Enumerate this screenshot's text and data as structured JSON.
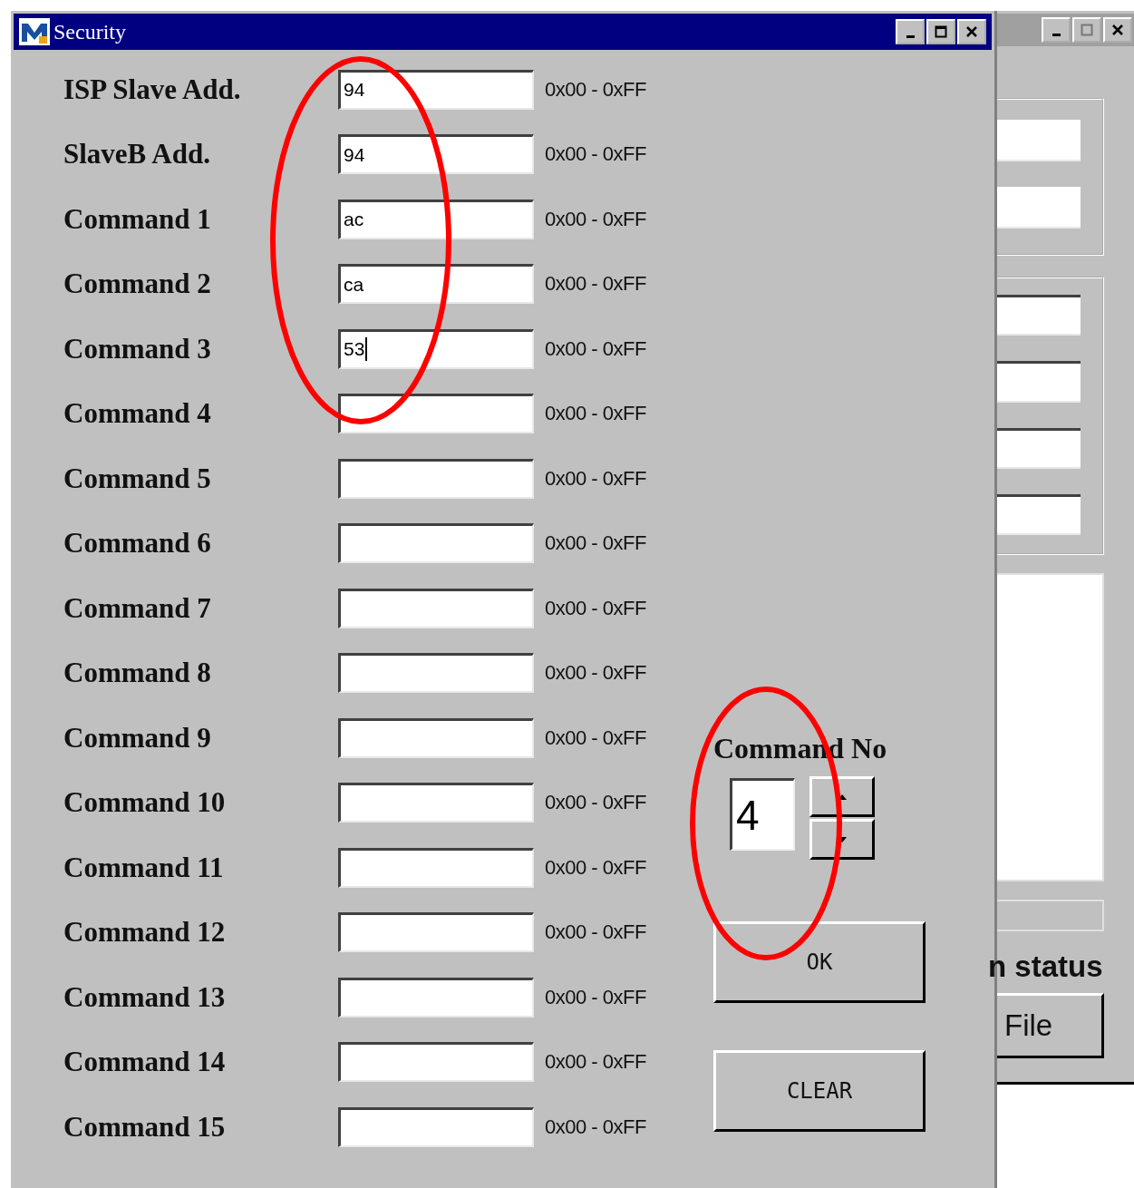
{
  "window": {
    "title": "Security"
  },
  "fields": [
    {
      "label": "ISP Slave Add.",
      "value": "94",
      "range": "0x00 - 0xFF",
      "focused": false
    },
    {
      "label": "SlaveB Add.",
      "value": "94",
      "range": "0x00 - 0xFF",
      "focused": false
    },
    {
      "label": "Command 1",
      "value": "ac",
      "range": "0x00 - 0xFF",
      "focused": false
    },
    {
      "label": "Command 2",
      "value": "ca",
      "range": "0x00 - 0xFF",
      "focused": false
    },
    {
      "label": "Command 3",
      "value": "53",
      "range": "0x00 - 0xFF",
      "focused": true
    },
    {
      "label": "Command 4",
      "range": "0x00 - 0xFF",
      "focused": false
    },
    {
      "label": "Command 5",
      "range": "0x00 - 0xFF",
      "focused": false
    },
    {
      "label": "Command 6",
      "range": "0x00 - 0xFF",
      "focused": false
    },
    {
      "label": "Command 7",
      "range": "0x00 - 0xFF",
      "focused": false
    },
    {
      "label": "Command 8",
      "range": "0x00 - 0xFF",
      "focused": false
    },
    {
      "label": "Command 9",
      "range": "0x00 - 0xFF",
      "focused": false
    },
    {
      "label": "Command 10",
      "range": "0x00 - 0xFF",
      "focused": false
    },
    {
      "label": "Command 11",
      "range": "0x00 - 0xFF",
      "focused": false
    },
    {
      "label": "Command 12",
      "range": "0x00 - 0xFF",
      "focused": false
    },
    {
      "label": "Command 13",
      "range": "0x00 - 0xFF",
      "focused": false
    },
    {
      "label": "Command 14",
      "range": "0x00 - 0xFF",
      "focused": false
    },
    {
      "label": "Command 15",
      "range": "0x00 - 0xFF",
      "focused": false
    }
  ],
  "command_no": {
    "label": "Command No",
    "value": "4"
  },
  "buttons": [
    "OK",
    "CLEAR"
  ],
  "background_window": {
    "status_label": "n status",
    "file_button": "File"
  }
}
